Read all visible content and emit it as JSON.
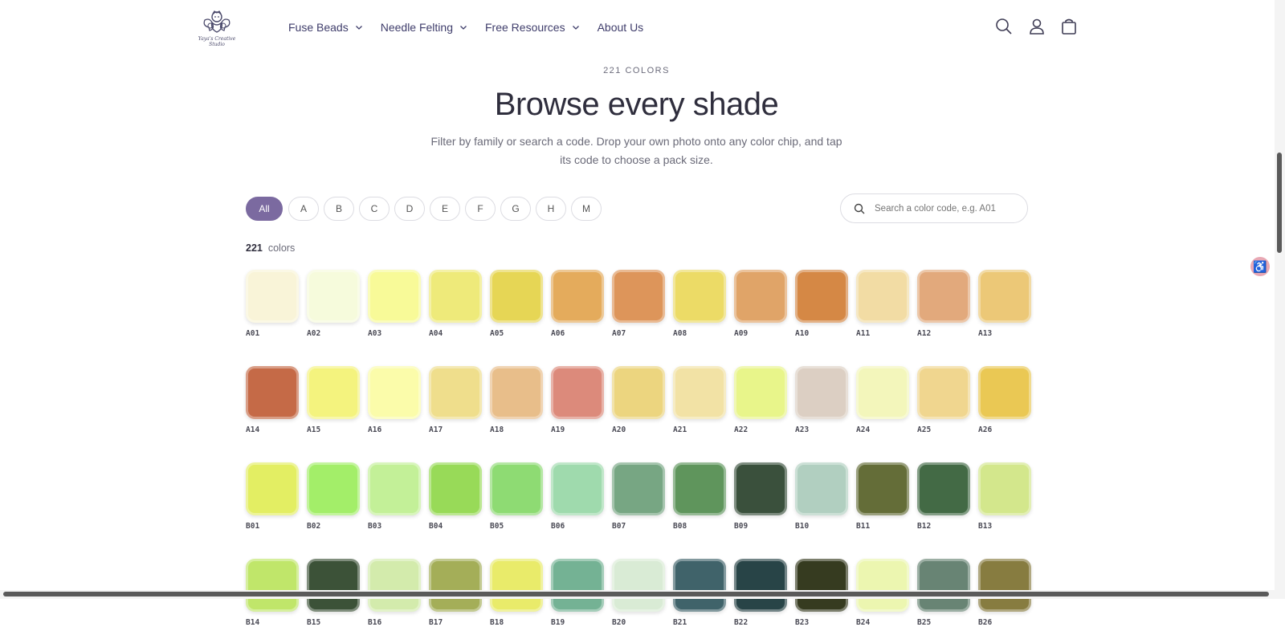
{
  "header": {
    "logo_text": "Yaya's Creative Studio",
    "nav": [
      {
        "label": "Fuse Beads",
        "dropdown": true
      },
      {
        "label": "Needle Felting",
        "dropdown": true
      },
      {
        "label": "Free Resources",
        "dropdown": true
      },
      {
        "label": "About Us",
        "dropdown": false
      }
    ],
    "icons": [
      "search-icon",
      "account-icon",
      "cart-icon"
    ]
  },
  "hero": {
    "kicker": "221 COLORS",
    "title": "Browse every shade",
    "subtitle": "Filter by family or search a code. Drop your own photo onto any color chip, and tap its code to choose a pack size."
  },
  "filters": {
    "pills": [
      "All",
      "A",
      "B",
      "C",
      "D",
      "E",
      "F",
      "G",
      "H",
      "M"
    ],
    "active": "All",
    "search_placeholder": "Search a color code, e.g. A01"
  },
  "results": {
    "count": "221",
    "label": "colors"
  },
  "colors": [
    {
      "code": "A01",
      "hex": "#f9f4d8"
    },
    {
      "code": "A02",
      "hex": "#f6fbdc"
    },
    {
      "code": "A03",
      "hex": "#f8fa98"
    },
    {
      "code": "A04",
      "hex": "#eeea7a"
    },
    {
      "code": "A05",
      "hex": "#e6d655"
    },
    {
      "code": "A06",
      "hex": "#e4ab5c"
    },
    {
      "code": "A07",
      "hex": "#dd955a"
    },
    {
      "code": "A08",
      "hex": "#ecdb66"
    },
    {
      "code": "A09",
      "hex": "#e0a468"
    },
    {
      "code": "A10",
      "hex": "#d58845"
    },
    {
      "code": "A11",
      "hex": "#f2dca4"
    },
    {
      "code": "A12",
      "hex": "#e2a97c"
    },
    {
      "code": "A13",
      "hex": "#ecc877"
    },
    {
      "code": "A14",
      "hex": "#c56a47"
    },
    {
      "code": "A15",
      "hex": "#f4f37e"
    },
    {
      "code": "A16",
      "hex": "#fbfcaa"
    },
    {
      "code": "A17",
      "hex": "#efde8c"
    },
    {
      "code": "A18",
      "hex": "#e8be8a"
    },
    {
      "code": "A19",
      "hex": "#dc8a7b"
    },
    {
      "code": "A20",
      "hex": "#ecd57f"
    },
    {
      "code": "A21",
      "hex": "#f2e2a5"
    },
    {
      "code": "A22",
      "hex": "#e8f58a"
    },
    {
      "code": "A23",
      "hex": "#dccfc3"
    },
    {
      "code": "A24",
      "hex": "#f3f6bb"
    },
    {
      "code": "A25",
      "hex": "#f0d68f"
    },
    {
      "code": "A26",
      "hex": "#eac854"
    },
    {
      "code": "B01",
      "hex": "#e3ee63"
    },
    {
      "code": "B02",
      "hex": "#a3ee69"
    },
    {
      "code": "B03",
      "hex": "#c3f098"
    },
    {
      "code": "B04",
      "hex": "#98da58"
    },
    {
      "code": "B05",
      "hex": "#8edb73"
    },
    {
      "code": "B06",
      "hex": "#9fdaad"
    },
    {
      "code": "B07",
      "hex": "#77a683"
    },
    {
      "code": "B08",
      "hex": "#5f955c"
    },
    {
      "code": "B09",
      "hex": "#3a503c"
    },
    {
      "code": "B10",
      "hex": "#b1cfc0"
    },
    {
      "code": "B11",
      "hex": "#646d38"
    },
    {
      "code": "B12",
      "hex": "#436a45"
    },
    {
      "code": "B13",
      "hex": "#d3e78c"
    },
    {
      "code": "B14",
      "hex": "#c0e66a"
    },
    {
      "code": "B15",
      "hex": "#3c5238"
    },
    {
      "code": "B16",
      "hex": "#d3ebac"
    },
    {
      "code": "B17",
      "hex": "#a4ae58"
    },
    {
      "code": "B18",
      "hex": "#e9eb6a"
    },
    {
      "code": "B19",
      "hex": "#74b294"
    },
    {
      "code": "B20",
      "hex": "#d9ebd5"
    },
    {
      "code": "B21",
      "hex": "#40636a"
    },
    {
      "code": "B22",
      "hex": "#284447"
    },
    {
      "code": "B23",
      "hex": "#363b20"
    },
    {
      "code": "B24",
      "hex": "#ecf6b0"
    },
    {
      "code": "B25",
      "hex": "#688474"
    },
    {
      "code": "B26",
      "hex": "#877c40"
    }
  ]
}
